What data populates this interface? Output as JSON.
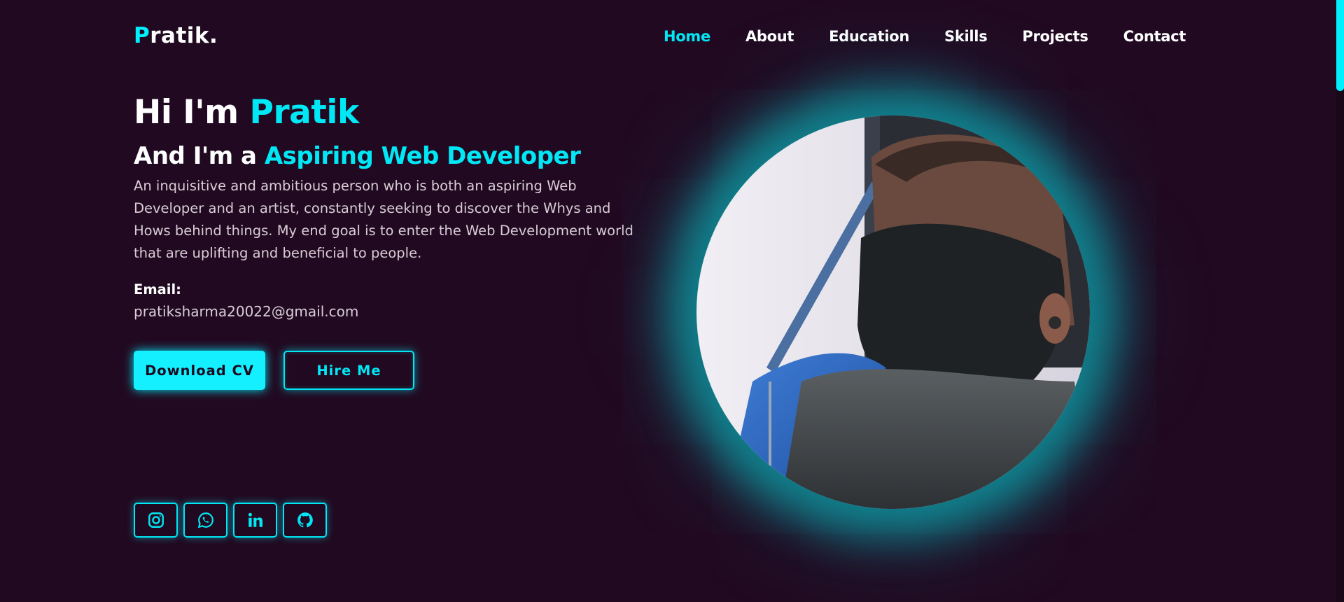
{
  "logo": {
    "first": "P",
    "rest": "ratik."
  },
  "nav": {
    "items": [
      "Home",
      "About",
      "Education",
      "Skills",
      "Projects",
      "Contact"
    ],
    "active": "Home"
  },
  "hero": {
    "greeting": "Hi I'm ",
    "name": "Pratik",
    "role_prefix": "And I'm a ",
    "role": "Aspiring Web Developer",
    "description": "An inquisitive and ambitious person who is both an aspiring Web Developer and an artist, constantly seeking to discover the Whys and Hows behind things. My end goal is to enter the Web Development world that are uplifting and beneficial to people.",
    "email_label": "Email:",
    "email": "pratiksharma20022@gmail.com"
  },
  "buttons": {
    "download_cv": "Download CV",
    "hire_me": "Hire Me"
  },
  "socials": [
    "instagram-icon",
    "whatsapp-icon",
    "linkedin-icon",
    "github-icon"
  ],
  "colors": {
    "background": "#210a21",
    "accent": "#00e8f5",
    "text_muted": "#d9cdd6"
  }
}
